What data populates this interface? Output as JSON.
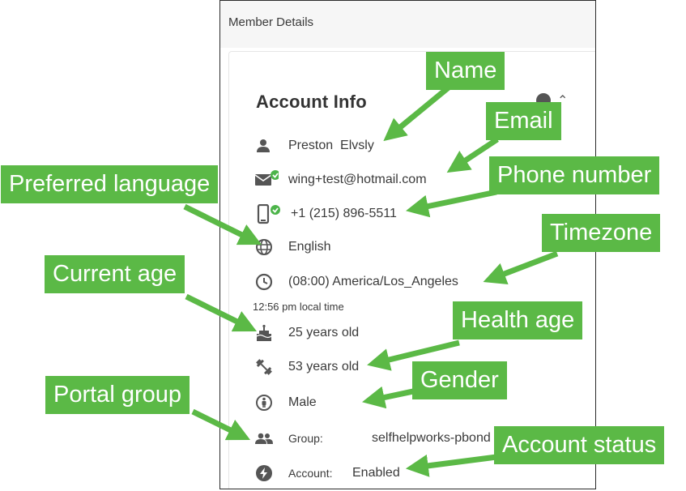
{
  "panel": {
    "title": "Member Details",
    "card_title": "Account Info"
  },
  "fields": {
    "name_first": "Preston",
    "name_last": "Elvsly",
    "email": "wing+test@hotmail.com",
    "phone": "+1 (215) 896-5511",
    "language": "English",
    "timezone": "(08:00) America/Los_Angeles",
    "local_time": "12:56 pm local time",
    "current_age": "25 years old",
    "health_age": "53 years old",
    "gender": "Male",
    "group_label": "Group:",
    "group_value": "selfhelpworks-pbond",
    "account_label": "Account:",
    "account_value": "Enabled"
  },
  "callouts": {
    "name": "Name",
    "email": "Email",
    "phone": "Phone number",
    "language": "Preferred language",
    "timezone": "Timezone",
    "current_age": "Current age",
    "health_age": "Health age",
    "gender": "Gender",
    "portal_group": "Portal group",
    "account_status": "Account status"
  },
  "icons": {
    "name": "person-icon",
    "email": "email-verified-icon",
    "phone": "phone-verified-icon",
    "language": "globe-icon",
    "timezone": "clock-icon",
    "current_age": "cake-icon",
    "health_age": "dumbbell-icon",
    "gender": "gender-icon",
    "group": "group-icon",
    "account": "bolt-icon"
  },
  "colors": {
    "callout_bg": "#5bb946",
    "verified": "#4cb44a",
    "icon": "#555555"
  }
}
